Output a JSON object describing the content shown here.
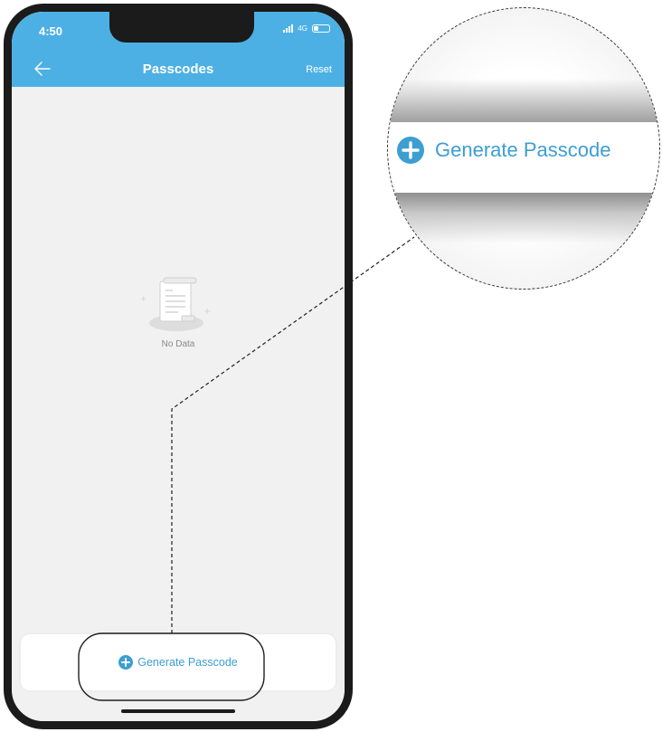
{
  "status_bar": {
    "time": "4:50",
    "network": "4G"
  },
  "nav": {
    "title": "Passcodes",
    "reset_label": "Reset"
  },
  "empty_state": {
    "message": "No Data"
  },
  "bottom_bar": {
    "generate_label": "Generate Passcode"
  },
  "magnifier": {
    "generate_label": "Generate Passcode"
  },
  "colors": {
    "header": "#4db0e4",
    "accent": "#3d9ed2",
    "background": "#f1f1f1"
  },
  "icons": {
    "back": "arrow-left-icon",
    "add": "plus-circle-icon",
    "empty": "document-icon"
  }
}
